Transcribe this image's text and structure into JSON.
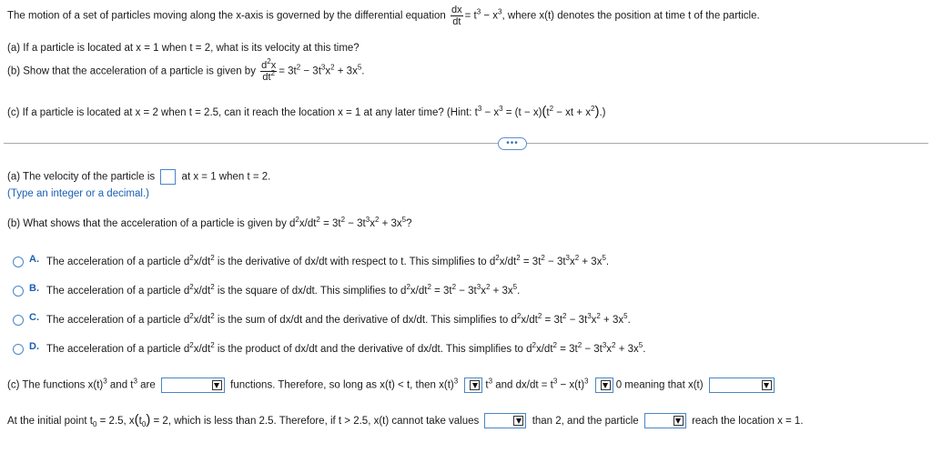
{
  "question": {
    "intro_a": "The motion of a set of particles moving along the x-axis is governed by the differential equation",
    "eq_num": "dx",
    "eq_den": "dt",
    "intro_eq": "= t",
    "intro_eq2": " − x",
    "intro_b": ", where x(t) denotes the position at time t of the particle.",
    "part_a": "(a) If a particle is located at x = 1 when t = 2, what is its velocity at this time?",
    "part_b_pre": "(b) Show that the acceleration of a particle is given by",
    "part_b_num": "x",
    "part_b_den": "dt",
    "part_b_eq": "= 3t",
    "part_b_eq2": " − 3t",
    "part_b_eq3": "x",
    "part_b_eq4": " + 3x",
    "part_c_pre": "(c) If a particle is located at x = 2 when t = 2.5, can it reach the location x = 1 at any later time? (Hint: t",
    "part_c_mid": " − x",
    "part_c_mid2": " = (t − x)",
    "part_c_paren": "t",
    "part_c_paren2": " − xt + x",
    "part_c_end": ".)"
  },
  "more_button": "•••",
  "answer_a": {
    "pre": "(a) The velocity of the particle is",
    "post": "at x = 1 when t = 2.",
    "hint": "(Type an integer or a decimal.)"
  },
  "answer_b": {
    "question_pre": "(b) What shows that the acceleration of a particle is given by d",
    "question_mid": "x/dt",
    "question_eq": " = 3t",
    "question_eq2": " − 3t",
    "question_eq3": "x",
    "question_eq4": " + 3x",
    "question_end": "?",
    "options": [
      {
        "letter": "A.",
        "text": "The acceleration of a particle d",
        "text2": "x/dt",
        "text3": " is the derivative of dx/dt with respect to t. This simplifies to d",
        "text4": "x/dt",
        "text5": " = 3t",
        "text6": " − 3t",
        "text7": "x",
        "text8": " + 3x",
        "text9": "."
      },
      {
        "letter": "B.",
        "text": "The acceleration of a particle d",
        "text2": "x/dt",
        "text3": " is the square of dx/dt. This simplifies to d",
        "text4": "x/dt",
        "text5": " = 3t",
        "text6": " − 3t",
        "text7": "x",
        "text8": " + 3x",
        "text9": "."
      },
      {
        "letter": "C.",
        "text": "The acceleration of a particle d",
        "text2": "x/dt",
        "text3": " is the sum of dx/dt and the derivative of dx/dt. This simplifies to d",
        "text4": "x/dt",
        "text5": " = 3t",
        "text6": " − 3t",
        "text7": "x",
        "text8": " + 3x",
        "text9": "."
      },
      {
        "letter": "D.",
        "text": "The acceleration of a particle d",
        "text2": "x/dt",
        "text3": " is the product of dx/dt and the derivative of dx/dt. This simplifies to d",
        "text4": "x/dt",
        "text5": " = 3t",
        "text6": " − 3t",
        "text7": "x",
        "text8": " + 3x",
        "text9": "."
      }
    ]
  },
  "answer_c": {
    "line1_pre": "(c) The functions x(t)",
    "line1_and": " and t",
    "line1_are": " are",
    "line1_mid": "functions. Therefore, so long as x(t) < t, then x(t)",
    "line1_t": "t",
    "line1_dx": " and dx/dt = t",
    "line1_dx2": " − x(t)",
    "line1_end": "0 meaning that x(t)",
    "line2_pre": "At the initial point t",
    "line2_sub": "0",
    "line2_eq": " = 2.5, x",
    "line2_t0": "t",
    "line2_sub2": "0",
    "line2_mid": " = 2, which is less than 2.5. Therefore, if t > 2.5, x(t) cannot take values",
    "line2_than": "than 2, and the particle",
    "line2_end": "reach the location x = 1."
  },
  "exponents": {
    "two": "2",
    "three": "3",
    "five": "5"
  }
}
